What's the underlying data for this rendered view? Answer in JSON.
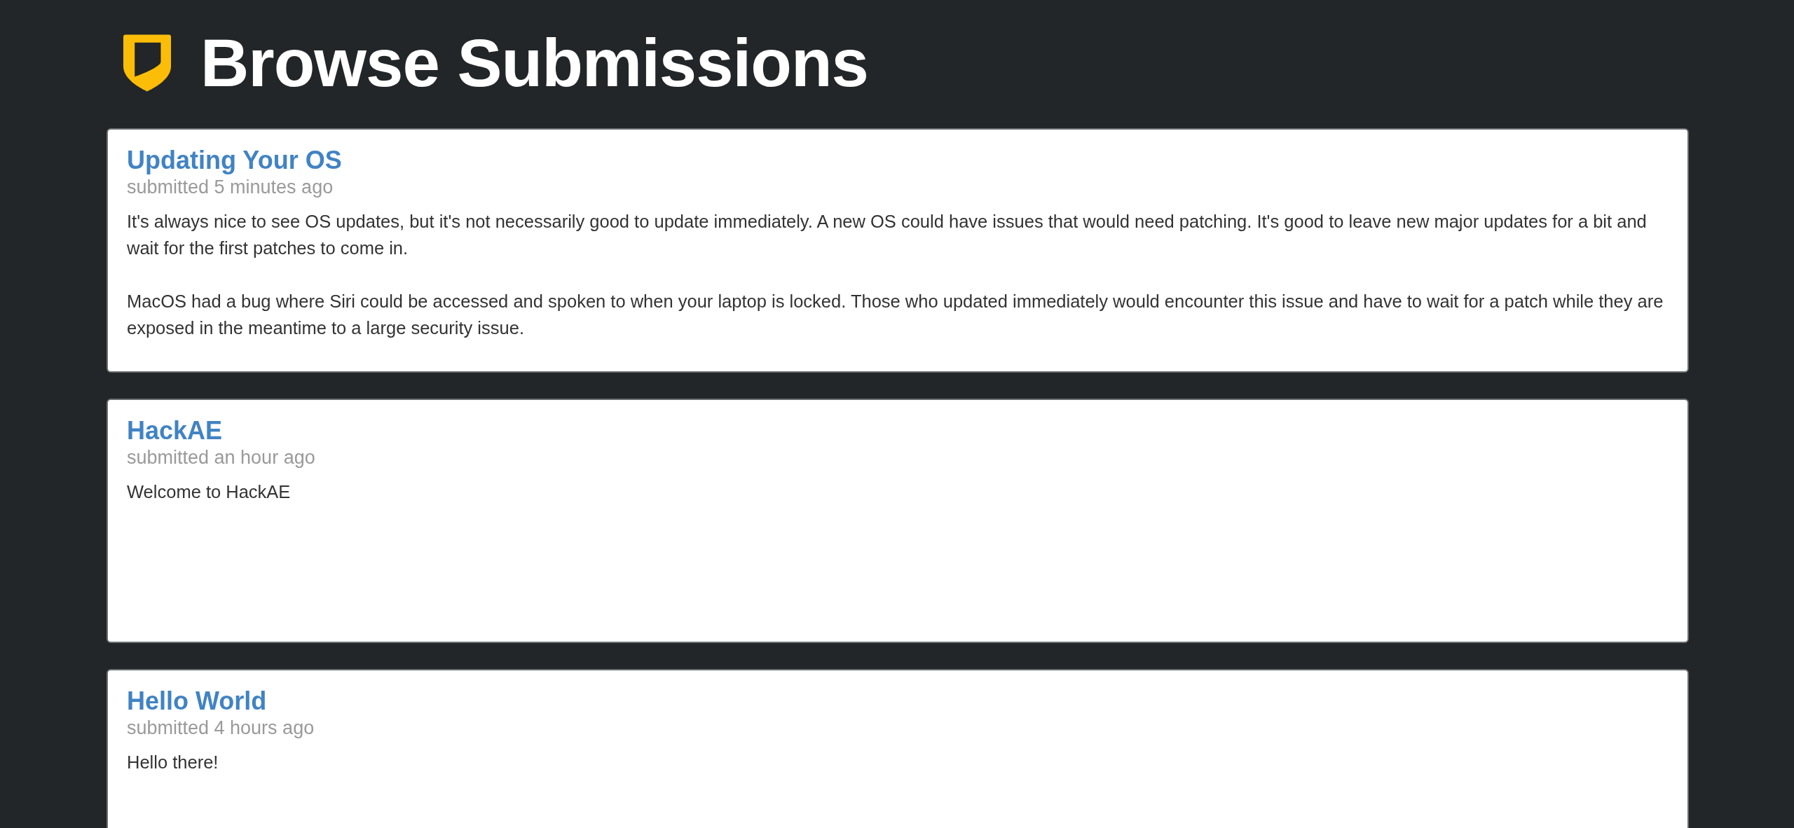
{
  "page": {
    "title": "Browse Submissions"
  },
  "submissions": [
    {
      "title": "Updating Your OS",
      "meta": "submitted 5 minutes ago",
      "paragraphs": [
        "It's always nice to see OS updates, but it's not necessarily good to update immediately. A new OS could have issues that would need patching. It's good to leave new major updates for a bit and wait for the first patches to come in.",
        "MacOS had a bug where Siri could be accessed and spoken to when your laptop is locked. Those who updated immediately would encounter this issue and have to wait for a patch while they are exposed in the meantime to a large security issue."
      ]
    },
    {
      "title": "HackAE",
      "meta": "submitted an hour ago",
      "paragraphs": [
        "Welcome to HackAE"
      ]
    },
    {
      "title": "Hello World",
      "meta": "submitted 4 hours ago",
      "paragraphs": [
        "Hello there!"
      ]
    }
  ]
}
